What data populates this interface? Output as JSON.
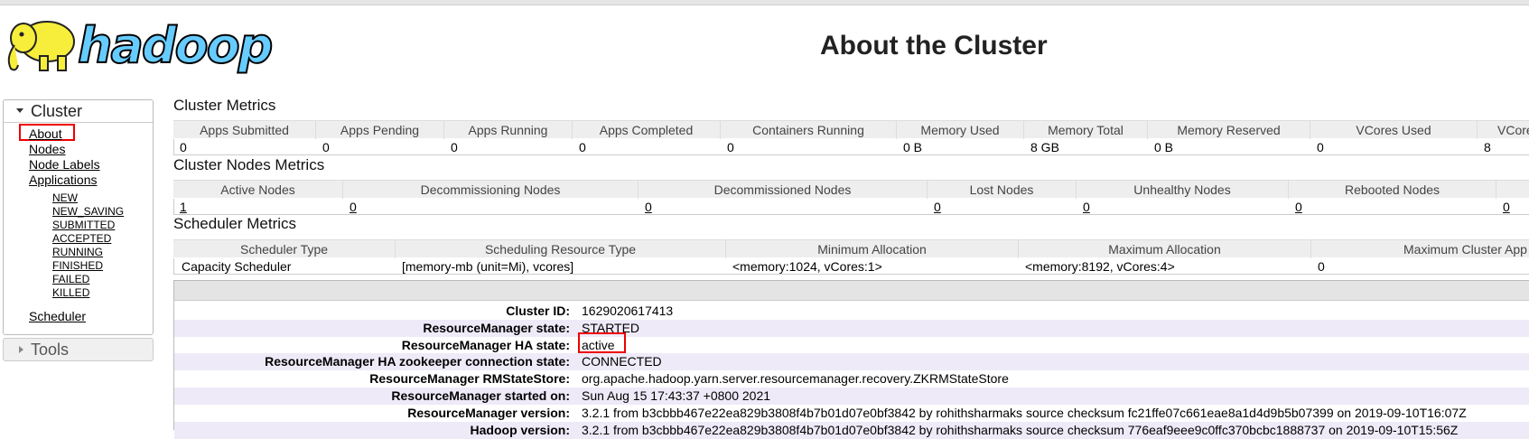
{
  "header": {
    "logo_text": "hadoop",
    "title": "About the Cluster"
  },
  "sidebar": {
    "cluster_label": "Cluster",
    "items": [
      "About",
      "Nodes",
      "Node Labels",
      "Applications"
    ],
    "app_states": [
      "NEW",
      "NEW_SAVING",
      "SUBMITTED",
      "ACCEPTED",
      "RUNNING",
      "FINISHED",
      "FAILED",
      "KILLED"
    ],
    "scheduler_label": "Scheduler",
    "tools_label": "Tools"
  },
  "cluster_metrics": {
    "title": "Cluster Metrics",
    "headers": [
      "Apps Submitted",
      "Apps Pending",
      "Apps Running",
      "Apps Completed",
      "Containers Running",
      "Memory Used",
      "Memory Total",
      "Memory Reserved",
      "VCores Used",
      "VCores Total"
    ],
    "values": [
      "0",
      "0",
      "0",
      "0",
      "0",
      "0 B",
      "8 GB",
      "0 B",
      "0",
      "8"
    ]
  },
  "node_metrics": {
    "title": "Cluster Nodes Metrics",
    "headers": [
      "Active Nodes",
      "Decommissioning Nodes",
      "Decommissioned Nodes",
      "Lost Nodes",
      "Unhealthy Nodes",
      "Rebooted Nodes",
      ""
    ],
    "values": [
      "1",
      "0",
      "0",
      "0",
      "0",
      "0",
      "0"
    ]
  },
  "scheduler_metrics": {
    "title": "Scheduler Metrics",
    "headers": [
      "Scheduler Type",
      "Scheduling Resource Type",
      "Minimum Allocation",
      "Maximum Allocation",
      "Maximum Cluster App"
    ],
    "values": [
      "Capacity Scheduler",
      "[memory-mb (unit=Mi), vcores]",
      "<memory:1024, vCores:1>",
      "<memory:8192, vCores:4>",
      "0"
    ]
  },
  "info": {
    "rows": [
      {
        "label": "Cluster ID:",
        "value": "1629020617413"
      },
      {
        "label": "ResourceManager state:",
        "value": "STARTED"
      },
      {
        "label": "ResourceManager HA state:",
        "value": "active"
      },
      {
        "label": "ResourceManager HA zookeeper connection state:",
        "value": "CONNECTED"
      },
      {
        "label": "ResourceManager RMStateStore:",
        "value": "org.apache.hadoop.yarn.server.resourcemanager.recovery.ZKRMStateStore"
      },
      {
        "label": "ResourceManager started on:",
        "value": "Sun Aug 15 17:43:37 +0800 2021"
      },
      {
        "label": "ResourceManager version:",
        "value": "3.2.1 from b3cbbb467e22ea829b3808f4b7b01d07e0bf3842 by rohithsharmaks source checksum fc21ffe07c661eae8a1d4d9b5b07399 on 2019-09-10T16:07Z"
      },
      {
        "label": "Hadoop version:",
        "value": "3.2.1 from b3cbbb467e22ea829b3808f4b7b01d07e0bf3842 by rohithsharmaks source checksum 776eaf9eee9c0ffc370bcbc1888737 on 2019-09-10T15:56Z"
      }
    ]
  },
  "colors": {
    "highlight": "#ee0000",
    "row_alt": "#efeaf8",
    "header_bg": "#eeeeee"
  }
}
